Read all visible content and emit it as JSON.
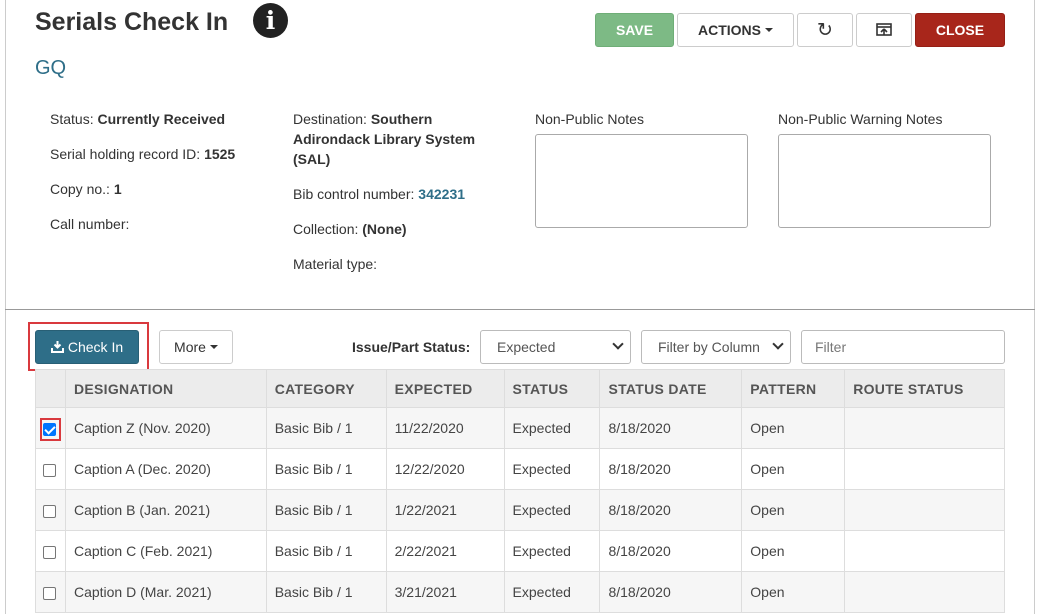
{
  "header": {
    "title": "Serials Check In",
    "subtitle": "GQ"
  },
  "toolbar": {
    "save_label": "SAVE",
    "actions_label": "ACTIONS",
    "refresh_icon": "refresh-icon",
    "print_icon": "open-in-window-icon",
    "close_label": "CLOSE"
  },
  "details": {
    "status_label": "Status:",
    "status_value": "Currently Received",
    "holding_label": "Serial holding record ID:",
    "holding_value": "1525",
    "copy_label": "Copy no.:",
    "copy_value": "1",
    "call_label": "Call number:",
    "destination_label": "Destination:",
    "destination_value": "Southern Adirondack Library System (SAL)",
    "bib_label": "Bib control number:",
    "bib_value": "342231",
    "collection_label": "Collection:",
    "collection_value": "(None)",
    "material_label": "Material type:"
  },
  "notes": {
    "public_label": "Non-Public Notes",
    "warning_label": "Non-Public Warning Notes"
  },
  "controls": {
    "checkin_label": "Check In",
    "more_label": "More",
    "status_filter_label": "Issue/Part Status:",
    "status_selected": "Expected",
    "column_filter_selected": "Filter by Column",
    "filter_placeholder": "Filter"
  },
  "table": {
    "columns": [
      "DESIGNATION",
      "CATEGORY",
      "EXPECTED",
      "STATUS",
      "STATUS DATE",
      "PATTERN",
      "ROUTE STATUS"
    ],
    "rows": [
      {
        "checked": true,
        "designation": "Caption Z (Nov. 2020)",
        "category": "Basic Bib / 1",
        "expected": "11/22/2020",
        "status": "Expected",
        "status_date": "8/18/2020",
        "pattern": "Open",
        "route_status": ""
      },
      {
        "checked": false,
        "designation": "Caption A (Dec. 2020)",
        "category": "Basic Bib / 1",
        "expected": "12/22/2020",
        "status": "Expected",
        "status_date": "8/18/2020",
        "pattern": "Open",
        "route_status": ""
      },
      {
        "checked": false,
        "designation": "Caption B (Jan. 2021)",
        "category": "Basic Bib / 1",
        "expected": "1/22/2021",
        "status": "Expected",
        "status_date": "8/18/2020",
        "pattern": "Open",
        "route_status": ""
      },
      {
        "checked": false,
        "designation": "Caption C (Feb. 2021)",
        "category": "Basic Bib / 1",
        "expected": "2/22/2021",
        "status": "Expected",
        "status_date": "8/18/2020",
        "pattern": "Open",
        "route_status": ""
      },
      {
        "checked": false,
        "designation": "Caption D (Mar. 2021)",
        "category": "Basic Bib / 1",
        "expected": "3/21/2021",
        "status": "Expected",
        "status_date": "8/18/2020",
        "pattern": "Open",
        "route_status": ""
      }
    ]
  },
  "colors": {
    "save": "#7dba85",
    "close": "#a8261b",
    "primary": "#2e6e88",
    "highlight": "#d9393e"
  }
}
